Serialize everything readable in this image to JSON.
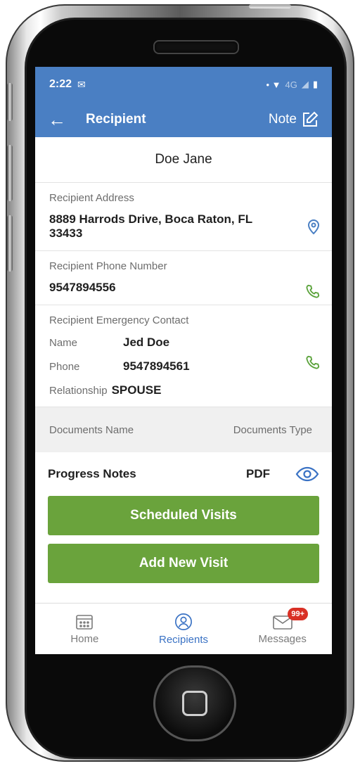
{
  "status": {
    "time": "2:22",
    "network": "4G"
  },
  "header": {
    "title": "Recipient",
    "note_label": "Note"
  },
  "recipient": {
    "name": "Doe Jane"
  },
  "address": {
    "label": "Recipient Address",
    "value": "8889 Harrods Drive, Boca Raton, FL 33433"
  },
  "phone": {
    "label": "Recipient Phone Number",
    "value": "9547894556"
  },
  "emergency": {
    "label": "Recipient Emergency Contact",
    "name_key": "Name",
    "name_value": "Jed Doe",
    "phone_key": "Phone",
    "phone_value": "9547894561",
    "relationship_key": "Relationship",
    "relationship_value": "SPOUSE"
  },
  "documents": {
    "col_name": "Documents Name",
    "col_type": "Documents Type",
    "rows": [
      {
        "name": "Progress Notes",
        "type": "PDF"
      }
    ]
  },
  "actions": {
    "scheduled_visits": "Scheduled Visits",
    "add_new_visit": "Add New Visit"
  },
  "tabs": [
    {
      "label": "Home",
      "icon": "calendar-icon"
    },
    {
      "label": "Recipients",
      "icon": "user-icon"
    },
    {
      "label": "Messages",
      "icon": "mail-icon",
      "badge": "99+"
    }
  ],
  "colors": {
    "primary": "#4a7fc3",
    "action": "#6aa33c",
    "phone_icon": "#5aa23a",
    "badge": "#d93025"
  }
}
